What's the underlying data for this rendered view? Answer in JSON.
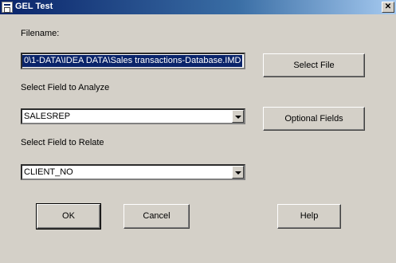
{
  "window": {
    "title": "GEL Test",
    "close_glyph": "✕"
  },
  "form": {
    "filename_label": "Filename:",
    "filename_value": "0\\1-DATA\\IDEA DATA\\Sales transactions-Database.IMD",
    "analyze_label": "Select Field to Analyze",
    "analyze_value": "SALESREP",
    "relate_label": "Select Field to Relate",
    "relate_value": "CLIENT_NO"
  },
  "buttons": {
    "select_file": "Select File",
    "optional_fields": "Optional Fields",
    "ok": "OK",
    "cancel": "Cancel",
    "help": "Help"
  },
  "colors": {
    "title_bar": "#0a246a",
    "dialog_bg": "#d4d0c8",
    "selection": "#0a246a"
  }
}
